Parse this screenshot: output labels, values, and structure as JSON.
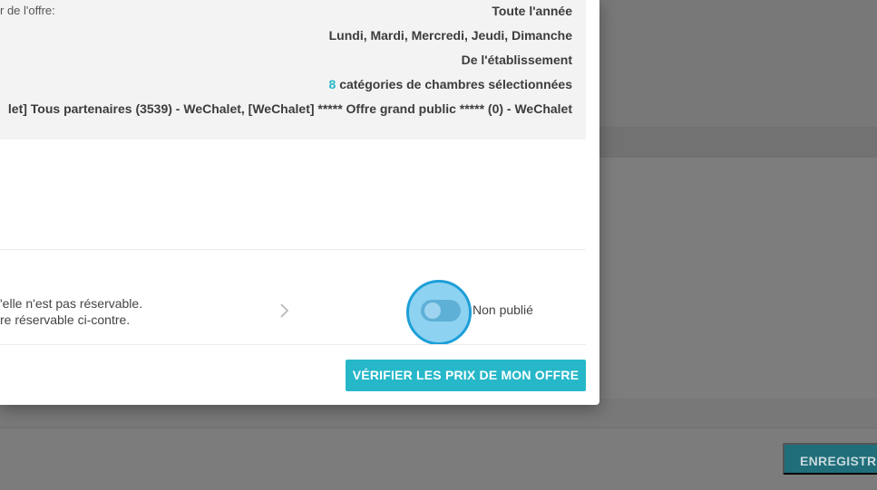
{
  "summary": {
    "label": "r de l'offre:",
    "period": "Toute l'année",
    "days": "Lundi, Mardi, Mercredi, Jeudi, Dimanche",
    "source": "De l'établissement",
    "room_count": "8",
    "room_text": " catégories de chambres sélectionnées",
    "partners": "let] Tous partenaires (3539) - WeChalet, [WeChalet] ***** Offre grand public ***** (0) - WeChalet"
  },
  "booking": {
    "line1": "'elle n'est pas réservable.",
    "line2": "re réservable ci-contre.",
    "toggle_label": "Non publié",
    "toggle_on": false
  },
  "actions": {
    "verify_label": "VÉRIFIER LES PRIX DE MON OFFRE"
  },
  "background_app": {
    "save_label": "ENREGISTRE"
  },
  "colors": {
    "accent": "#26b8c9",
    "highlight": "#26b6c8",
    "toggle_halo_border": "#1d9fd8"
  }
}
